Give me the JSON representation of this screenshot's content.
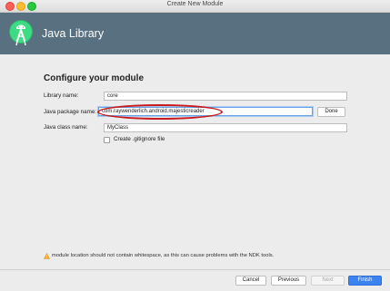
{
  "window": {
    "title": "Create New Module"
  },
  "header": {
    "title": "Java Library"
  },
  "form": {
    "section_title": "Configure your module",
    "library_name": {
      "label": "Library name:",
      "value": "core"
    },
    "package_name": {
      "label": "Java package name:",
      "value": "com.raywenderlich.android.majesticreader",
      "button": "Done"
    },
    "class_name": {
      "label": "Java class name:",
      "value": "MyClass"
    },
    "gitignore": {
      "label": "Create .gitignore file",
      "checked": false
    }
  },
  "warning": {
    "text": "module location should not contain whitespace, as this can cause problems with the NDK tools."
  },
  "footer": {
    "cancel": "Cancel",
    "previous": "Previous",
    "next": "Next",
    "finish": "Finish"
  },
  "colors": {
    "header": "#58707f",
    "accent": "#3b83f0",
    "annotation": "#c8191c",
    "android_green": "#3ddc84"
  },
  "icons": {
    "logo": "android-studio-logo-icon",
    "warning": "warning-icon"
  }
}
